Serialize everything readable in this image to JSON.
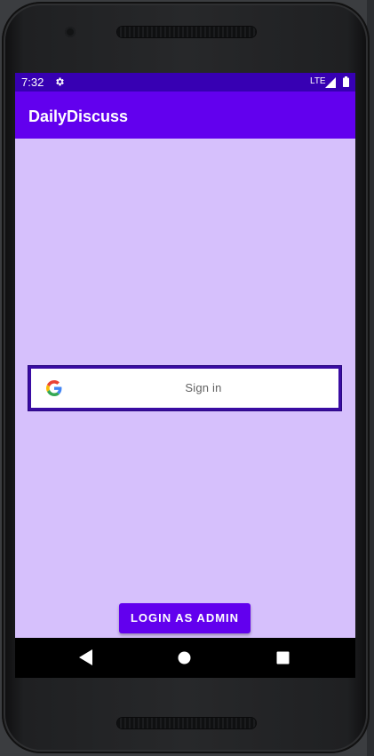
{
  "status_bar": {
    "time": "7:32",
    "network": "LTE",
    "icons": [
      "settings-gear-icon",
      "signal-icon",
      "battery-icon"
    ]
  },
  "app_bar": {
    "title": "DailyDiscuss"
  },
  "google_sign_in": {
    "label": "Sign in",
    "icon": "google-logo-icon"
  },
  "admin_login": {
    "label": "LOGIN AS ADMIN"
  },
  "nav_bar": {
    "icons": [
      "back-icon",
      "home-icon",
      "recents-icon"
    ]
  },
  "colors": {
    "status_bar": "#3700b3",
    "primary": "#6200ee",
    "background": "#d6c0fc",
    "sign_in_border": "#3a0ca3"
  }
}
